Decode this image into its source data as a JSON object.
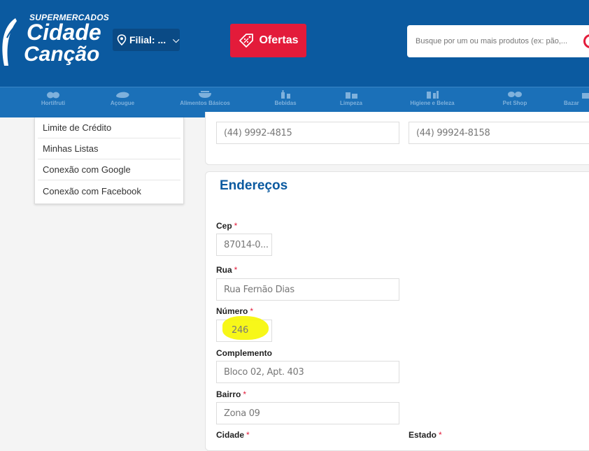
{
  "header": {
    "logo": {
      "line1": "SUPERMERCADOS",
      "line2": "Cidade",
      "line3": "Canção"
    },
    "filial_label": "Filial: ...",
    "ofertas_label": "Ofertas",
    "search_placeholder": "Busque por um ou mais produtos (ex: pão,..."
  },
  "categories": [
    {
      "name": "Hortifruti",
      "icon": "fruit-icon"
    },
    {
      "name": "Açougue",
      "icon": "meat-icon"
    },
    {
      "name": "Alimentos Básicos",
      "icon": "bowl-icon"
    },
    {
      "name": "Bebidas",
      "icon": "bottles-icon"
    },
    {
      "name": "Limpeza",
      "icon": "cleaning-icon"
    },
    {
      "name": "Higiene e Beleza",
      "icon": "hygiene-icon"
    },
    {
      "name": "Pet Shop",
      "icon": "pet-icon"
    },
    {
      "name": "Bazar",
      "icon": "bazar-icon"
    }
  ],
  "sidebar": {
    "items": [
      "Limite de Crédito",
      "Minhas Listas",
      "Conexão com Google",
      "Conexão com Facebook"
    ]
  },
  "contact": {
    "phone1": "(44) 9992-4815",
    "phone2": "(44) 99924-8158"
  },
  "address": {
    "title": "Endereços",
    "cep_label": "Cep",
    "cep_value": "87014-0...",
    "rua_label": "Rua",
    "rua_value": "Rua Fernão Dias",
    "numero_label": "Número",
    "numero_value": "246",
    "complemento_label": "Complemento",
    "complemento_value": "Bloco 02, Apt. 403",
    "bairro_label": "Bairro",
    "bairro_value": "Zona 09",
    "cidade_label": "Cidade",
    "estado_label": "Estado",
    "required_mark": "*"
  },
  "colors": {
    "header_bg": "#0b5aa0",
    "category_bar": "#1b70b8",
    "ofertas_bg": "#e31b3a",
    "title_blue": "#0b5aa0",
    "highlight": "#f6f600"
  }
}
